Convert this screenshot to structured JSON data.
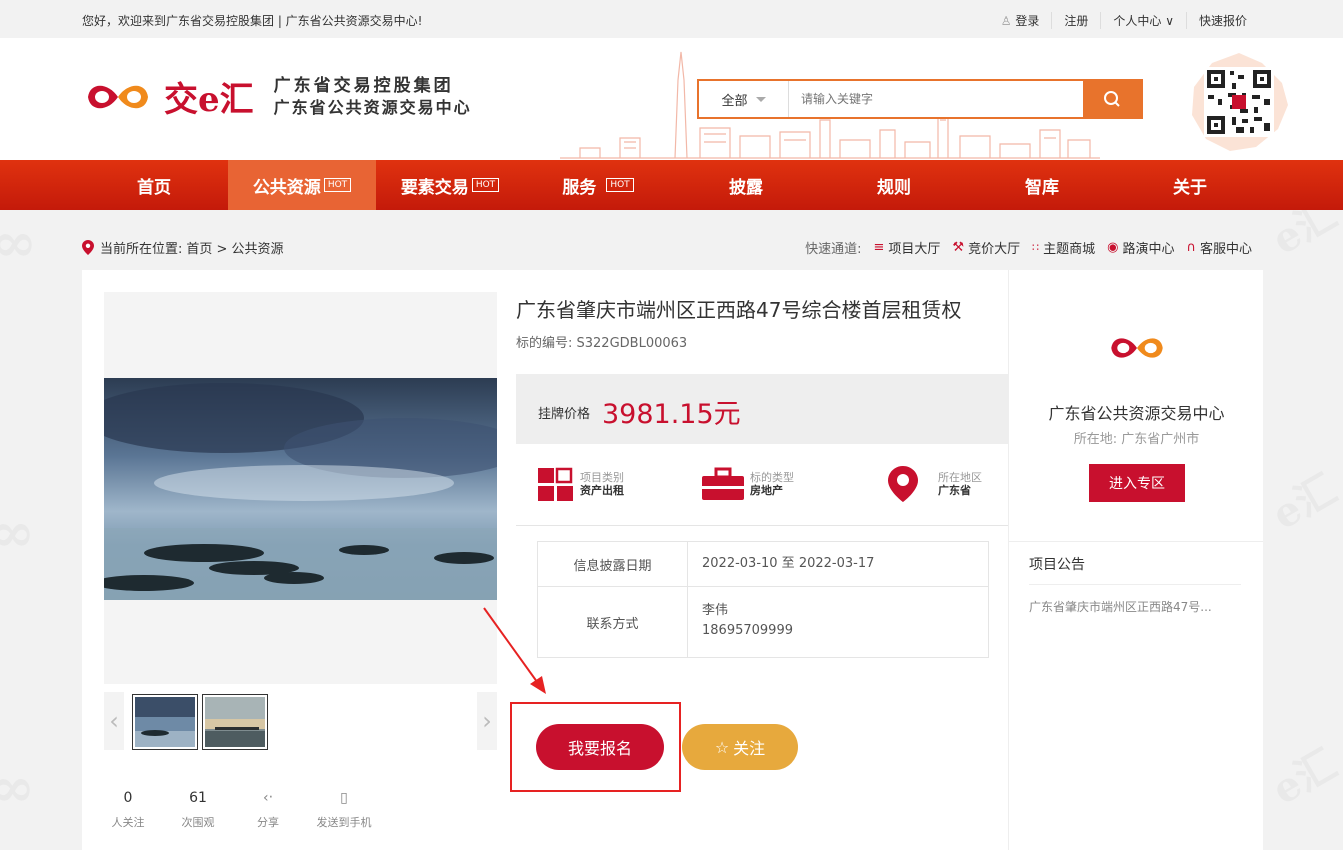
{
  "topbar": {
    "welcome": "您好，欢迎来到广东省交易控股集团 | 广东省公共资源交易中心!",
    "login": "登录",
    "register": "注册",
    "personal": "个人中心",
    "quote": "快速报价"
  },
  "header": {
    "logo_text": "交e汇",
    "org_line1": "广东省交易控股集团",
    "org_line2": "广东省公共资源交易中心",
    "search_category": "全部",
    "search_placeholder": "请输入关键字"
  },
  "nav": {
    "items": [
      {
        "label": "首页",
        "hot": ""
      },
      {
        "label": "公共资源",
        "hot": "HOT"
      },
      {
        "label": "要素交易",
        "hot": "HOT"
      },
      {
        "label": "服务",
        "hot": "HOT"
      },
      {
        "label": "披露",
        "hot": ""
      },
      {
        "label": "规则",
        "hot": ""
      },
      {
        "label": "智库",
        "hot": ""
      },
      {
        "label": "关于",
        "hot": ""
      }
    ]
  },
  "breadcrumb": {
    "label": "当前所在位置:",
    "path": "首页 > 公共资源"
  },
  "quick": {
    "label": "快速通道:",
    "items": [
      "项目大厅",
      "竞价大厅",
      "主题商城",
      "路演中心",
      "客服中心"
    ]
  },
  "project": {
    "title": "广东省肇庆市端州区正西路47号综合楼首层租赁权",
    "code": "标的编号: S322GDBL00063",
    "price_label": "挂牌价格",
    "price": "3981.15元",
    "attrs": [
      {
        "title": "项目类别",
        "value": "资产出租"
      },
      {
        "title": "标的类型",
        "value": "房地产"
      },
      {
        "title": "所在地区",
        "value": "广东省"
      }
    ],
    "info": {
      "date_label": "信息披露日期",
      "date_value": "2022-03-10 至 2022-03-17",
      "contact_label": "联系方式",
      "contact_name": "李伟",
      "contact_phone": "18695709999"
    },
    "signup_label": "我要报名",
    "follow_label": "关注"
  },
  "stats": [
    {
      "number": "0",
      "label": "人关注"
    },
    {
      "number": "61",
      "label": "次围观"
    },
    {
      "number": "",
      "label": "分享"
    },
    {
      "number": "",
      "label": "发送到手机"
    }
  ],
  "side": {
    "org_name": "广东省公共资源交易中心",
    "org_location": "所在地: 广东省广州市",
    "enter_label": "进入专区",
    "announce_header": "项目公告",
    "announce_item": "广东省肇庆市端州区正西路47号..."
  },
  "colors": {
    "brand_red": "#c8102e",
    "nav_red": "#d42a0c",
    "nav_active": "#e86434",
    "search_orange": "#e8732c",
    "follow_gold": "#e7a93d"
  }
}
